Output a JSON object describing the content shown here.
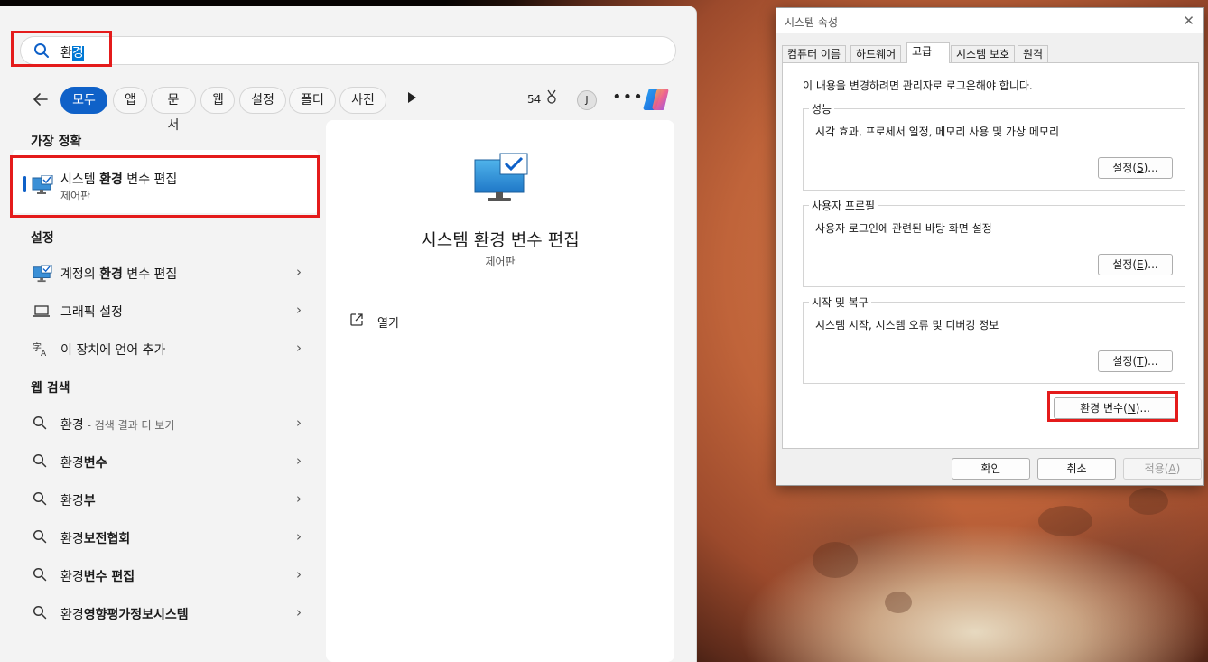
{
  "search": {
    "query_prefix": "환",
    "query_selected": "경"
  },
  "filters": {
    "chips": [
      "모두",
      "앱",
      "문서",
      "웹",
      "설정",
      "폴더",
      "사진"
    ],
    "points": "54",
    "avatar_initial": "J"
  },
  "best_match": {
    "heading": "가장 정확",
    "title_pre": "시스템 ",
    "title_bold": "환경",
    "title_post": " 변수 편집",
    "subtitle": "제어판"
  },
  "settings": {
    "heading": "설정",
    "items": [
      {
        "pre": "계정의 ",
        "bold": "환경",
        "post": " 변수 편집"
      },
      {
        "pre": "그래픽 설정",
        "bold": "",
        "post": ""
      },
      {
        "pre": "이 장치에 언어 추가",
        "bold": "",
        "post": ""
      }
    ]
  },
  "web": {
    "heading": "웹 검색",
    "items": [
      {
        "pre": "환경",
        "bold": "",
        "hint": " - 검색 결과 더 보기"
      },
      {
        "pre": "환경",
        "bold": "변수",
        "hint": ""
      },
      {
        "pre": "환경",
        "bold": "부",
        "hint": ""
      },
      {
        "pre": "환경",
        "bold": "보전협회",
        "hint": ""
      },
      {
        "pre": "환경",
        "bold": "변수 편집",
        "hint": ""
      },
      {
        "pre": "환경",
        "bold": "영향평가정보시스템",
        "hint": ""
      }
    ]
  },
  "detail": {
    "title": "시스템 환경 변수 편집",
    "subtitle": "제어판",
    "open_label": "열기"
  },
  "sysprops": {
    "window_title": "시스템 속성",
    "tabs": [
      "컴퓨터 이름",
      "하드웨어",
      "고급",
      "시스템 보호",
      "원격"
    ],
    "admin_note": "이 내용을 변경하려면 관리자로 로그온해야 합니다.",
    "groups": [
      {
        "legend": "성능",
        "desc": "시각 효과, 프로세서 일정, 메모리 사용 및 가상 메모리",
        "btn_pre": "설정(",
        "btn_key": "S",
        "btn_post": ")..."
      },
      {
        "legend": "사용자 프로필",
        "desc": "사용자 로그인에 관련된 바탕 화면 설정",
        "btn_pre": "설정(",
        "btn_key": "E",
        "btn_post": ")..."
      },
      {
        "legend": "시작 및 복구",
        "desc": "시스템 시작, 시스템 오류 및 디버깅 정보",
        "btn_pre": "설정(",
        "btn_key": "T",
        "btn_post": ")..."
      }
    ],
    "env_btn": {
      "pre": "환경 변수(",
      "key": "N",
      "post": ")..."
    },
    "ok": "확인",
    "cancel": "취소",
    "apply": {
      "pre": "적용(",
      "key": "A",
      "post": ")"
    }
  },
  "colors": {
    "accent": "#0f61c8",
    "highlight_box": "#e41b1b"
  },
  "icons": [
    "search-icon",
    "back-arrow-icon",
    "play-icon",
    "medal-icon",
    "more-icon",
    "copilot-icon",
    "monitor-check-icon",
    "laptop-icon",
    "language-icon",
    "chevron-right-icon",
    "open-external-icon",
    "close-icon"
  ]
}
